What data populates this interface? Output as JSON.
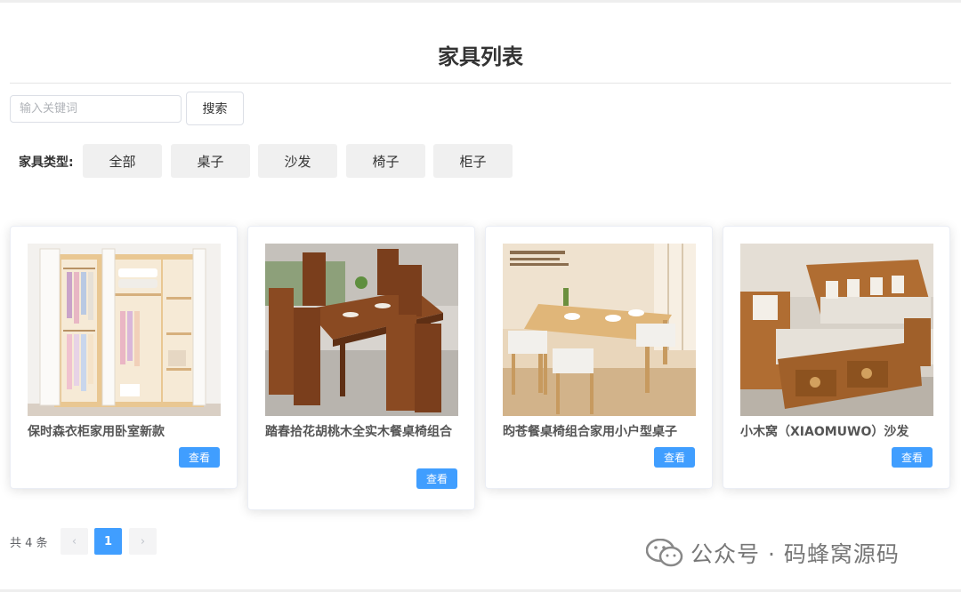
{
  "page": {
    "title": "家具列表"
  },
  "search": {
    "placeholder": "输入关键词",
    "button_label": "搜索"
  },
  "filter": {
    "label": "家具类型:",
    "options": [
      "全部",
      "桌子",
      "沙发",
      "椅子",
      "柜子"
    ]
  },
  "products": [
    {
      "title": "保时森衣柜家用卧室新款",
      "image": "wardrobe",
      "button_label": "查看"
    },
    {
      "title": "踏春拾花胡桃木全实木餐桌椅组合",
      "image": "dining-table",
      "button_label": "查看"
    },
    {
      "title": "昀苍餐桌椅组合家用小户型桌子",
      "image": "small-dining-table",
      "button_label": "查看"
    },
    {
      "title": "小木窝（XIAOMUWO）沙发",
      "image": "wooden-sofa",
      "button_label": "查看"
    }
  ],
  "pagination": {
    "total_text": "共 4 条",
    "current_page": "1",
    "prev_icon": "chevron-left-icon",
    "next_icon": "chevron-right-icon"
  },
  "watermark": {
    "text": "公众号 · 码蜂窝源码",
    "icon": "wechat-icon"
  },
  "colors": {
    "primary": "#409eff",
    "filter_bg": "#f0f0f0",
    "title": "#333333"
  }
}
